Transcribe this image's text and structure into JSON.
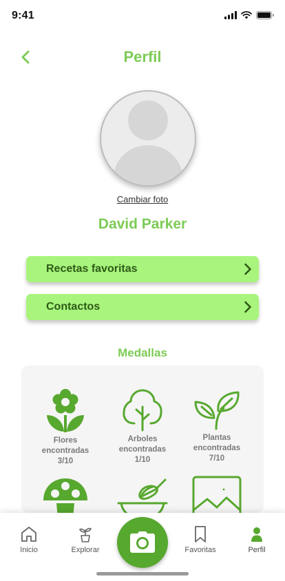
{
  "status_bar": {
    "time": "9:41"
  },
  "header": {
    "title": "Perfil",
    "back_icon": "chevron-left-icon"
  },
  "profile": {
    "avatar_icon": "user-placeholder-icon",
    "change_photo_label": "Cambiar foto",
    "name": "David Parker"
  },
  "menu": [
    {
      "label": "Recetas favoritas",
      "icon": "chevron-right-icon"
    },
    {
      "label": "Contactos",
      "icon": "chevron-right-icon"
    }
  ],
  "medals": {
    "title": "Medallas",
    "items": [
      {
        "icon": "flower-icon",
        "line1": "Flores",
        "line2": "encontradas",
        "progress": "3/10"
      },
      {
        "icon": "tree-icon",
        "line1": "Arboles",
        "line2": "encontradas",
        "progress": "1/10"
      },
      {
        "icon": "leaves-icon",
        "line1": "Plantas",
        "line2": "encontradas",
        "progress": "7/10"
      },
      {
        "icon": "mushroom-icon"
      },
      {
        "icon": "whisk-bowl-icon"
      },
      {
        "icon": "landscape-icon"
      }
    ]
  },
  "bottom_nav": {
    "items": [
      {
        "label": "Inicio",
        "icon": "home-icon"
      },
      {
        "label": "Explorar",
        "icon": "plant-pot-icon"
      },
      {
        "label": "Favoritas",
        "icon": "bookmark-icon"
      },
      {
        "label": "Perfil",
        "icon": "person-icon"
      }
    ],
    "camera_icon": "camera-icon"
  },
  "colors": {
    "accent": "#7ccb55",
    "button_bg": "#a8f47c",
    "button_text": "#2d5a17",
    "icon_green": "#57a82f"
  }
}
